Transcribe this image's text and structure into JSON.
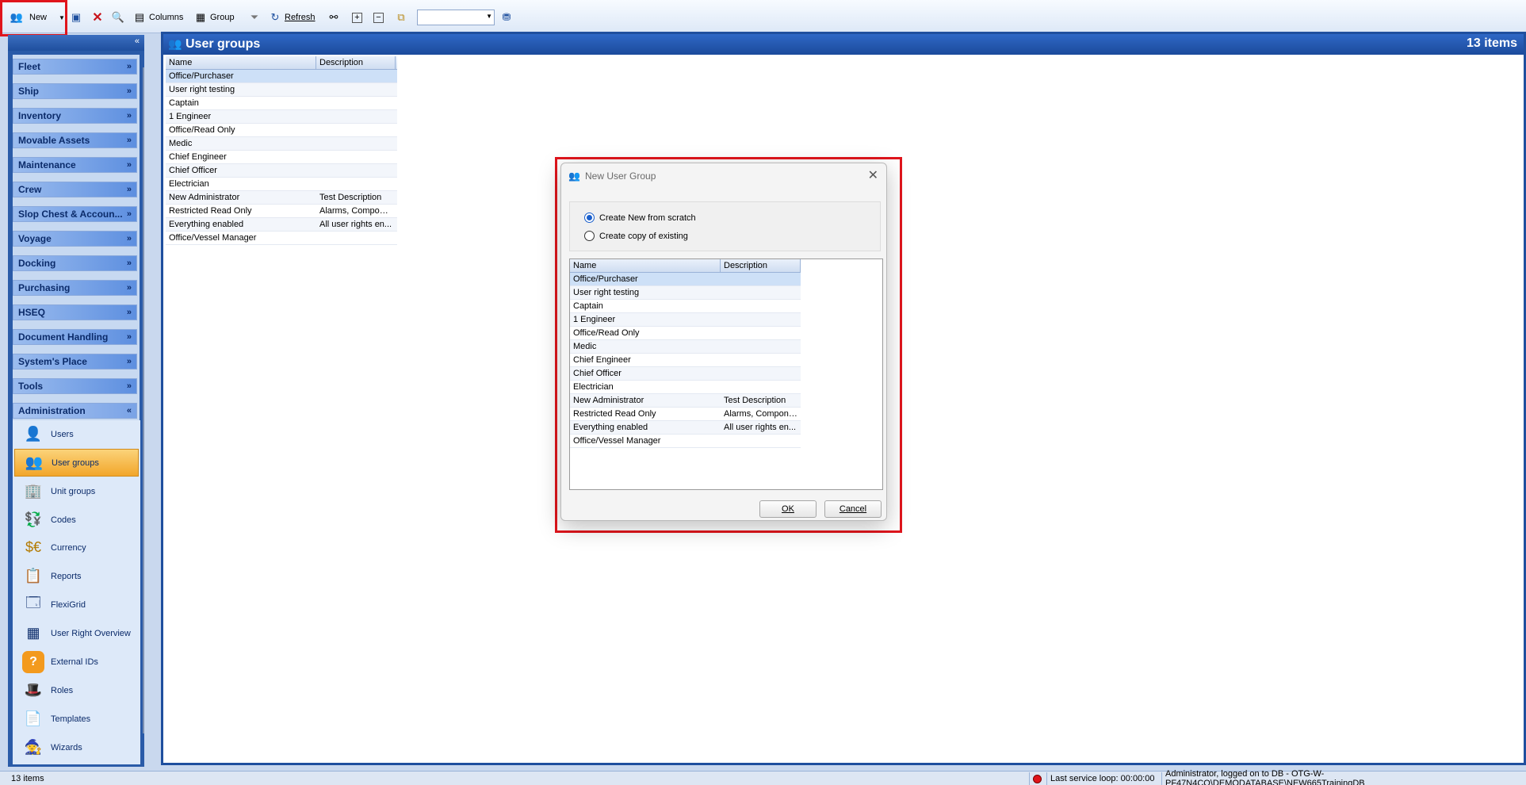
{
  "toolbar": {
    "new_label": "New",
    "columns_label": "Columns",
    "group_label": "Group",
    "refresh_label": "Refresh",
    "combo_value": ""
  },
  "nav": {
    "groups": [
      {
        "label": "Fleet"
      },
      {
        "label": "Ship"
      },
      {
        "label": "Inventory"
      },
      {
        "label": "Movable Assets"
      },
      {
        "label": "Maintenance"
      },
      {
        "label": "Crew"
      },
      {
        "label": "Slop Chest & Accoun..."
      },
      {
        "label": "Voyage"
      },
      {
        "label": "Docking"
      },
      {
        "label": "Purchasing"
      },
      {
        "label": "HSEQ"
      },
      {
        "label": "Document Handling"
      },
      {
        "label": "System's Place"
      },
      {
        "label": "Tools"
      },
      {
        "label": "Administration"
      }
    ],
    "admin_items": [
      {
        "label": "Users",
        "icon": "users-icon"
      },
      {
        "label": "User groups",
        "icon": "user-groups-icon"
      },
      {
        "label": "Unit groups",
        "icon": "unit-groups-icon"
      },
      {
        "label": "Codes",
        "icon": "codes-icon"
      },
      {
        "label": "Currency",
        "icon": "currency-icon"
      },
      {
        "label": "Reports",
        "icon": "reports-icon"
      },
      {
        "label": "FlexiGrid",
        "icon": "flexigrid-icon"
      },
      {
        "label": "User Right Overview",
        "icon": "user-right-overview-icon"
      },
      {
        "label": "External IDs",
        "icon": "external-ids-icon"
      },
      {
        "label": "Roles",
        "icon": "roles-icon"
      },
      {
        "label": "Templates",
        "icon": "templates-icon"
      },
      {
        "label": "Wizards",
        "icon": "wizards-icon"
      }
    ]
  },
  "main": {
    "title": "User groups",
    "count": "13 items",
    "columns": [
      "Name",
      "Description"
    ],
    "rows": [
      [
        "Office/Purchaser",
        ""
      ],
      [
        "User right testing",
        ""
      ],
      [
        "Captain",
        ""
      ],
      [
        "1 Engineer",
        ""
      ],
      [
        "Office/Read Only",
        ""
      ],
      [
        "Medic",
        ""
      ],
      [
        "Chief Engineer",
        ""
      ],
      [
        "Chief Officer",
        ""
      ],
      [
        "Electrician",
        ""
      ],
      [
        "New Administrator",
        "Test Description"
      ],
      [
        "Restricted Read Only",
        "Alarms, Compone..."
      ],
      [
        "Everything enabled",
        "All user rights en..."
      ],
      [
        "Office/Vessel Manager",
        ""
      ]
    ]
  },
  "dialog": {
    "title": "New User Group",
    "option_new": "Create New from scratch",
    "option_copy": "Create copy of existing",
    "ok_label": "OK",
    "cancel_label": "Cancel"
  },
  "status": {
    "items_count": "13 items",
    "service_loop": "Last service loop: 00:00:00",
    "login": "Administrator, logged on to DB - OTG-W-PF47N4CQ\\DEMODATABASE\\NEW665TrainingDB"
  },
  "colors": {
    "highlight": "#e0151c",
    "header_blue": "#1f4f9e",
    "selected_item": "#f2a62a"
  }
}
